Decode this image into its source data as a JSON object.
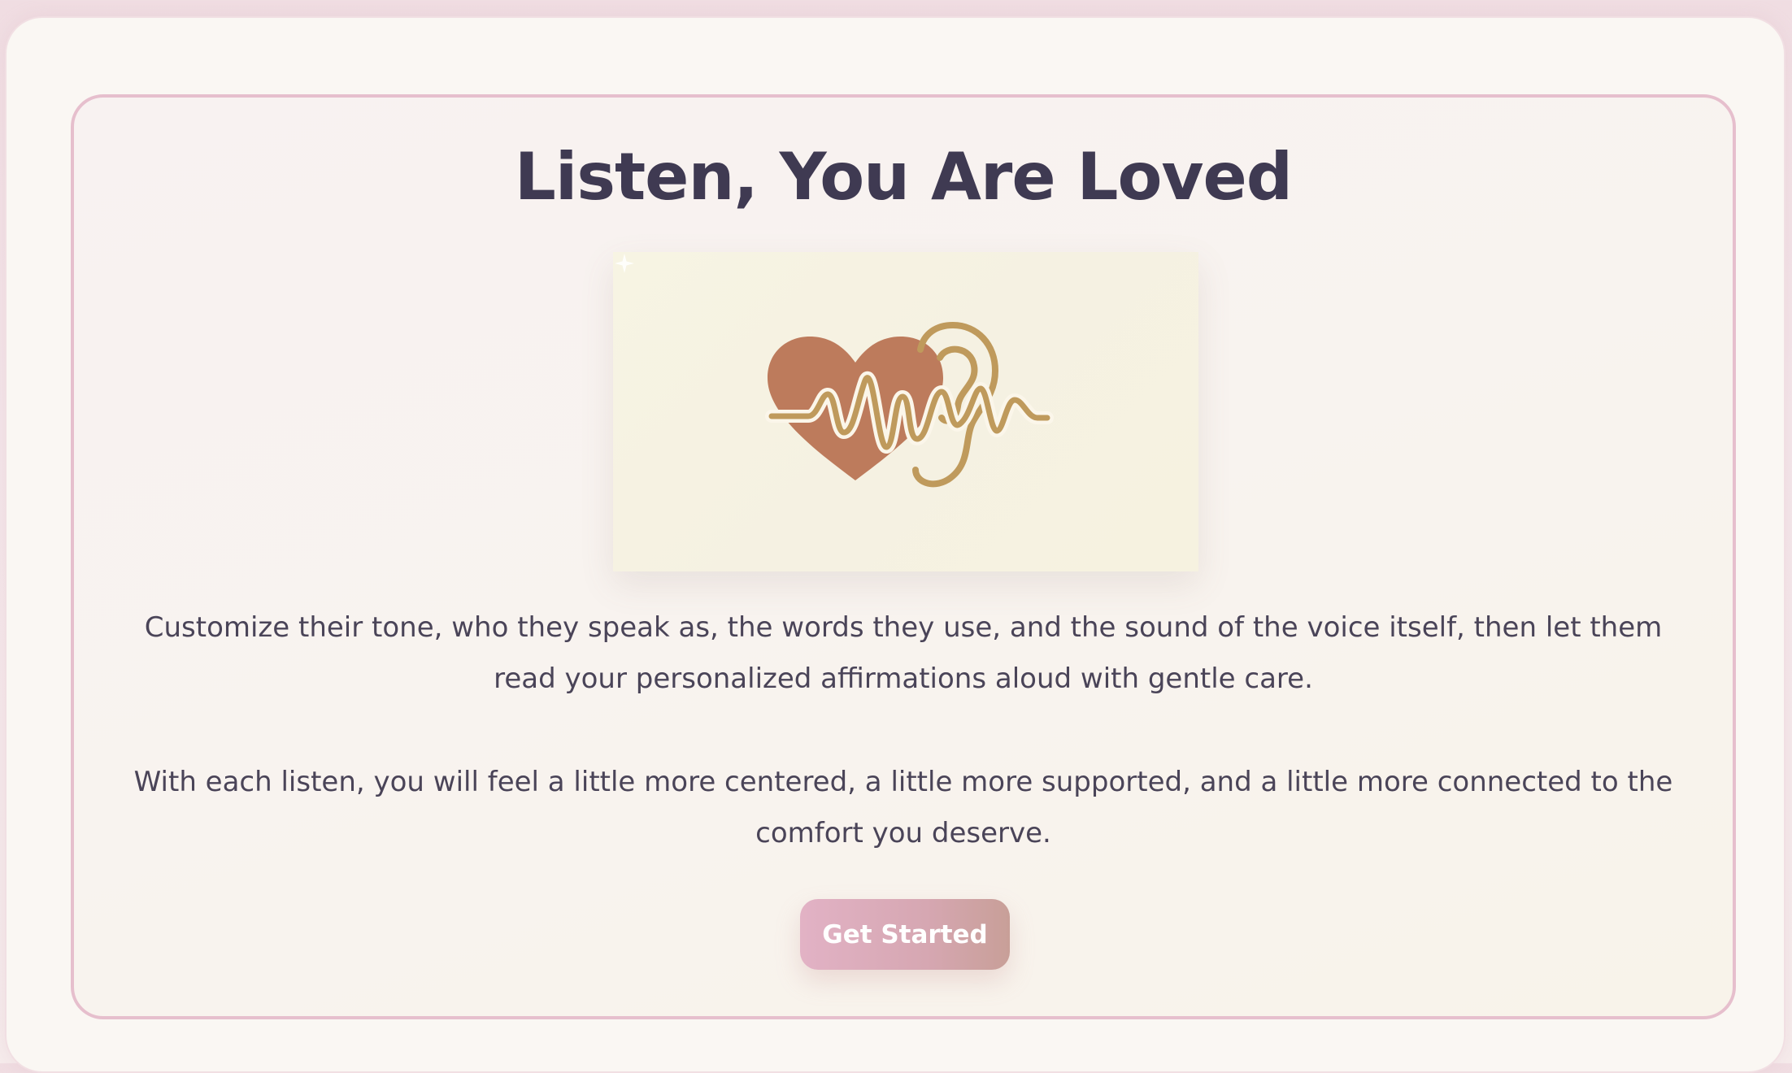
{
  "hero": {
    "title": "Listen, You Are Loved",
    "illustration": {
      "icon_name": "heart-ear-soundwave-illustration",
      "colors": {
        "heart": "#bd7b5c",
        "line": "#bf9a5c",
        "background": "#f6f3e3"
      }
    },
    "paragraphs": [
      "Customize their tone, who they speak as, the words they use, and the sound of the voice itself, then let them read your personalized affirmations aloud with gentle care.",
      "With each listen, you will feel a little more centered, a little more supported, and a little more connected to the comfort you deserve."
    ],
    "cta_label": "Get Started"
  },
  "colors": {
    "title_text": "#3f3a52",
    "body_text": "#4a4458",
    "inner_border": "#e6bfcd",
    "button_gradient_start": "#e2b2c5",
    "button_gradient_end": "#c89f98"
  }
}
